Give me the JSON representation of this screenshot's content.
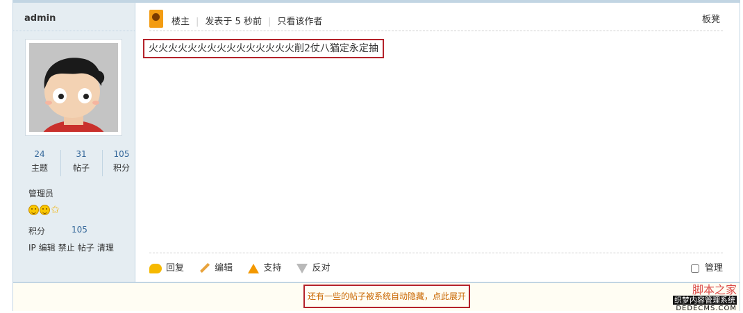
{
  "author": {
    "name": "admin"
  },
  "stats": [
    {
      "value": "24",
      "label": "主题"
    },
    {
      "value": "31",
      "label": "帖子"
    },
    {
      "value": "105",
      "label": "积分"
    }
  ],
  "user": {
    "group": "管理员",
    "score_label": "积分",
    "score_value": "105",
    "admin_links": [
      "IP",
      "编辑",
      "禁止",
      "帖子",
      "清理"
    ]
  },
  "post": {
    "role": "楼主",
    "time": "发表于 5 秒前",
    "only_author": "只看该作者",
    "floor": "板凳",
    "content": "火火火火火火火火火火火火火火火削2仗八猶定永定抽"
  },
  "actions": {
    "reply": "回复",
    "edit": "编辑",
    "support": "支持",
    "oppose": "反对",
    "manage": "管理"
  },
  "hidden_notice": "还有一些的帖子被系统自动隐藏，点此展开",
  "watermark": {
    "brand_cn": "脚本之家",
    "line1": "织梦内容管理系统",
    "line2": "DEDECMS.COM"
  },
  "colors": {
    "highlight_border": "#b4222a",
    "sidebar_bg": "#e5edf2",
    "link_blue": "#336699"
  }
}
